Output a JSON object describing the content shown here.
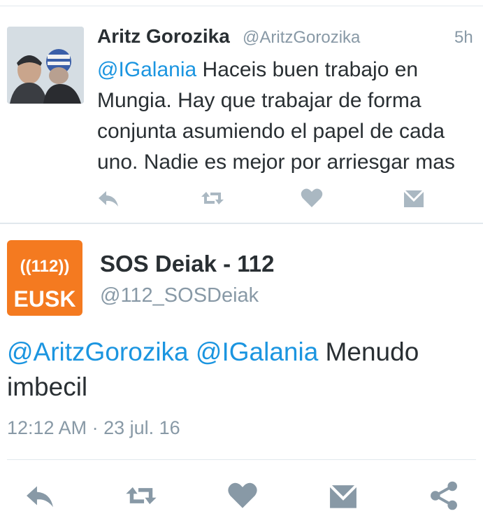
{
  "tweet1": {
    "name": "Aritz Gorozika",
    "handle": "@AritzGorozika",
    "time": "5h",
    "mention": "@IGalania",
    "text": " Haceis buen trabajo en Mungia. Hay que trabajar de forma conjunta asumiendo el papel de cada uno. Nadie es mejor por arriesgar mas",
    "actions": [
      "reply-icon",
      "retweet-icon",
      "like-icon",
      "message-icon"
    ]
  },
  "tweet2": {
    "name": "SOS Deiak - 112",
    "handle": "@112_SOSDeiak",
    "avatar_top": "((112))",
    "avatar_bottom": "EUSK",
    "mention1": "@AritzGorozika",
    "mention2": "@IGalania",
    "text": "  Menudo imbecil",
    "timestamp": "12:12 AM · 23 jul. 16",
    "actions": [
      "reply-icon",
      "retweet-icon",
      "like-icon",
      "message-icon",
      "share-icon"
    ]
  },
  "colors": {
    "mention": "#1b95e0",
    "muted": "#8899a6",
    "icon": "#aab8c2",
    "icon_large": "#8899a6",
    "avatar_orange": "#f47a20"
  }
}
